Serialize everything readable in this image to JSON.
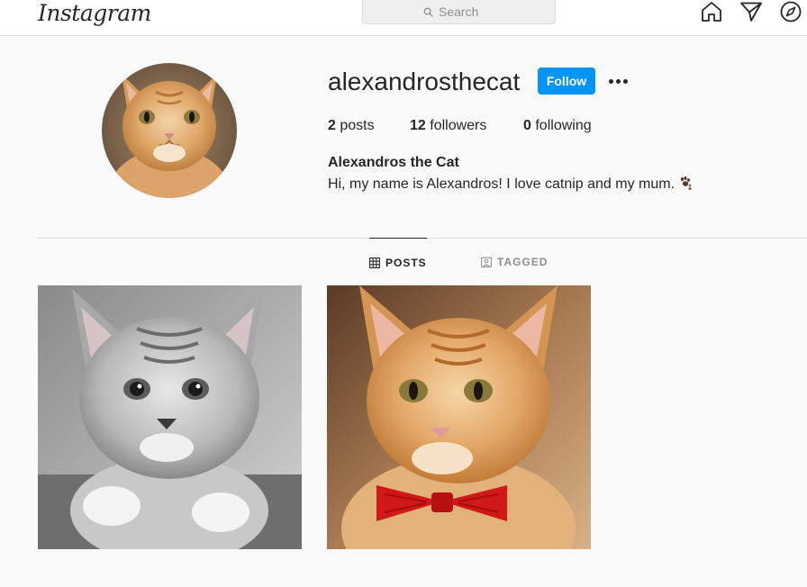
{
  "nav": {
    "logo": "Instagram",
    "search_placeholder": "Search",
    "icons": [
      "home-icon",
      "direct-icon",
      "explore-icon"
    ]
  },
  "profile": {
    "username": "alexandrosthecat",
    "follow_label": "Follow",
    "stats": {
      "posts_count": "2",
      "posts_label": "posts",
      "followers_count": "12",
      "followers_label": "followers",
      "following_count": "0",
      "following_label": "following"
    },
    "full_name": "Alexandros the Cat",
    "bio": "Hi, my name is Alexandros! I love catnip and my mum."
  },
  "tabs": [
    {
      "label": "POSTS",
      "active": true,
      "icon": "grid-icon"
    },
    {
      "label": "TAGGED",
      "active": false,
      "icon": "tagged-icon"
    }
  ],
  "posts": [
    {
      "description": "grey kitten photo, black and white"
    },
    {
      "description": "orange kitten wearing red bow tie"
    }
  ],
  "colors": {
    "accent": "#0095f6",
    "text": "#262626",
    "muted": "#8e8e8e",
    "background": "#fafafa",
    "border": "#dbdbdb"
  }
}
